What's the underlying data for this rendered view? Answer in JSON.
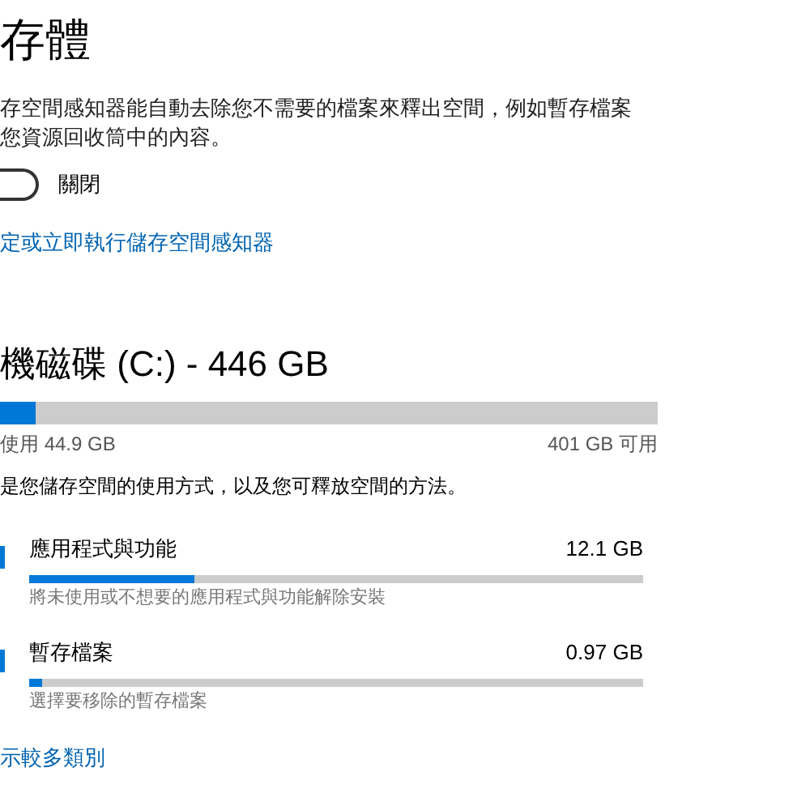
{
  "page_title": "存體",
  "description": [
    "存空間感知器能自動去除您不需要的檔案來釋出空間，例如暫存檔案",
    "您資源回收筒中的內容。"
  ],
  "storage_sense": {
    "on": false,
    "label": "關閉"
  },
  "configure_link": "定或立即執行儲存空間感知器",
  "drive": {
    "title": "機磁碟 (C:) - 446 GB",
    "level": 0.055,
    "used": "使用 44.9 GB",
    "free": "401 GB 可用"
  },
  "usage_intro": "是您儲存空間的使用方式，以及您可釋放空間的方法。",
  "categories": [
    {
      "name": "應用程式與功能",
      "size": "12.1 GB",
      "level": 0.27,
      "hint": "將未使用或不想要的應用程式與功能解除安裝"
    },
    {
      "name": "暫存檔案",
      "size": "0.97 GB",
      "level": 0.02,
      "hint": "選擇要移除的暫存檔案"
    }
  ],
  "more_link": "示較多類別"
}
